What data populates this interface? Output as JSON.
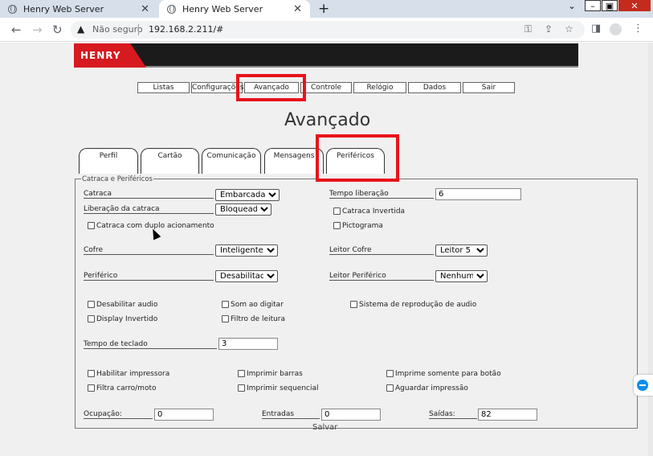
{
  "browser": {
    "tabs": [
      {
        "title": "Henry Web Server"
      },
      {
        "title": "Henry Web Server"
      }
    ],
    "new_tab_glyph": "+",
    "security_label": "Não seguro",
    "url": "192.168.2.211/#"
  },
  "brand": {
    "logo_text": "HENRY"
  },
  "menu": {
    "items": [
      "Listas",
      "Configurações",
      "Avançado",
      "Controle",
      "Relógio",
      "Dados",
      "Sair"
    ]
  },
  "page": {
    "title": "Avançado"
  },
  "tabs": [
    "Perfil",
    "Cartão",
    "Comunicação",
    "Mensagens",
    "Periféricos"
  ],
  "section": {
    "legend": "Catraca e Periféricos",
    "catraca": {
      "label": "Catraca",
      "value": "Embarcada"
    },
    "liberacao_catraca": {
      "label": "Liberação da catraca",
      "value": "Bloqueada"
    },
    "duplo_acionamento": "Catraca com duplo acionamento",
    "tempo_liberacao": {
      "label": "Tempo liberação",
      "value": "6"
    },
    "catraca_invertida": "Catraca Invertida",
    "pictograma": "Pictograma",
    "cofre": {
      "label": "Cofre",
      "value": "Inteligente"
    },
    "leitor_cofre": {
      "label": "Leitor Cofre",
      "value": "Leitor 5"
    },
    "periferico": {
      "label": "Periférico",
      "value": "Desabilitado"
    },
    "leitor_periferico": {
      "label": "Leitor Periférico",
      "value": "Nenhuma"
    },
    "desabilitar_audio": "Desabilitar audio",
    "som_ao_digitar": "Som ao digitar",
    "sistema_audio": "Sistema de reprodução de audio",
    "display_invertido": "Display Invertido",
    "filtro_leitura": "Filtro de leitura",
    "tempo_teclado": {
      "label": "Tempo de teclado",
      "value": "3"
    },
    "habilitar_impressora": "Habilitar impressora",
    "imprimir_barras": "Imprimir barras",
    "imprime_botao": "Imprime somente para botão",
    "filtra_carro": "Filtra carro/moto",
    "imprimir_sequencial": "Imprimir sequencial",
    "aguardar_impressao": "Aguardar impressão",
    "ocupacao": {
      "label": "Ocupação:",
      "value": "0"
    },
    "entradas": {
      "label": "Entradas",
      "value": "0"
    },
    "saidas": {
      "label": "Saídas:",
      "value": "82"
    },
    "salvar": "Salvar"
  },
  "colors": {
    "highlight": "#e8131b",
    "brand_red": "#d71920"
  }
}
